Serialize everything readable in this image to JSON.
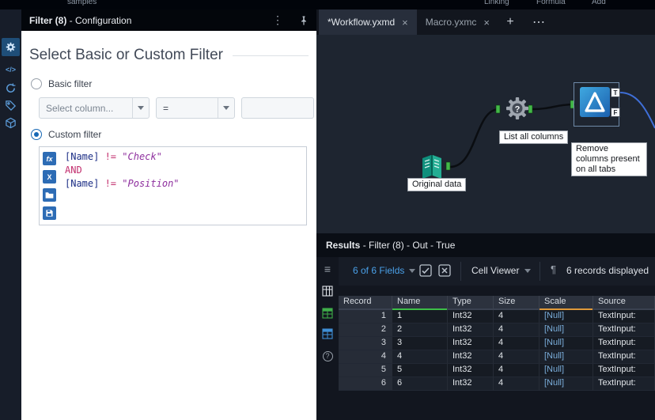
{
  "colors": {
    "accent_blue": "#4aa0e8",
    "quality_green": "#3dbf48",
    "quality_orange": "#e09a3a",
    "null_blue": "#7aadda",
    "selection_blue": "#1668b5",
    "wire_blue": "#3f6fd8"
  },
  "icons": {
    "kebab": "⋮",
    "menu": "≡",
    "pilcrow": "¶",
    "help": "?"
  },
  "top_strip": {
    "items": [
      "samples",
      "Linking",
      "Formula",
      "Add"
    ]
  },
  "config": {
    "title_bold": "Filter (8)",
    "title_rest": " - Configuration",
    "heading": "Select Basic or Custom Filter",
    "basic_label": "Basic filter",
    "custom_label": "Custom filter",
    "column_placeholder": "Select column...",
    "operator_value": "=",
    "expression": {
      "lines": [
        {
          "tokens": [
            {
              "text": "[Name] ",
              "type": "field"
            },
            {
              "text": "!= ",
              "type": "op"
            },
            {
              "text": "\"Check\"",
              "type": "string"
            }
          ]
        },
        {
          "tokens": [
            {
              "text": "AND",
              "type": "keyword"
            }
          ]
        },
        {
          "tokens": [
            {
              "text": "[Name] ",
              "type": "field"
            },
            {
              "text": "!= ",
              "type": "op"
            },
            {
              "text": "\"Position\"",
              "type": "string"
            }
          ]
        }
      ]
    }
  },
  "tabs": {
    "active": "*Workflow.yxmd",
    "inactive": "Macro.yxmc",
    "close": "×",
    "add": "+",
    "more": "⋯"
  },
  "canvas": {
    "nodes": [
      {
        "label": "Original data"
      },
      {
        "label": "List all columns"
      },
      {
        "label": "Remove columns present on all tabs",
        "outputs": [
          "T",
          "F"
        ]
      }
    ]
  },
  "results": {
    "header_bold": "Results",
    "header_rest": " - Filter (8) - Out - True",
    "fields_summary": "6 of 6 Fields",
    "cell_viewer": "Cell Viewer",
    "records_displayed": "6 records displayed",
    "table": {
      "columns": [
        "Record",
        "Name",
        "Type",
        "Size",
        "Scale",
        "Source"
      ],
      "quality_colors": [
        "none",
        "green",
        "none",
        "none",
        "orange",
        "none"
      ],
      "rows": [
        [
          "1",
          "1",
          "Int32",
          "4",
          "[Null]",
          "TextInput:"
        ],
        [
          "2",
          "2",
          "Int32",
          "4",
          "[Null]",
          "TextInput:"
        ],
        [
          "3",
          "3",
          "Int32",
          "4",
          "[Null]",
          "TextInput:"
        ],
        [
          "4",
          "4",
          "Int32",
          "4",
          "[Null]",
          "TextInput:"
        ],
        [
          "5",
          "5",
          "Int32",
          "4",
          "[Null]",
          "TextInput:"
        ],
        [
          "6",
          "6",
          "Int32",
          "4",
          "[Null]",
          "TextInput:"
        ]
      ]
    }
  }
}
